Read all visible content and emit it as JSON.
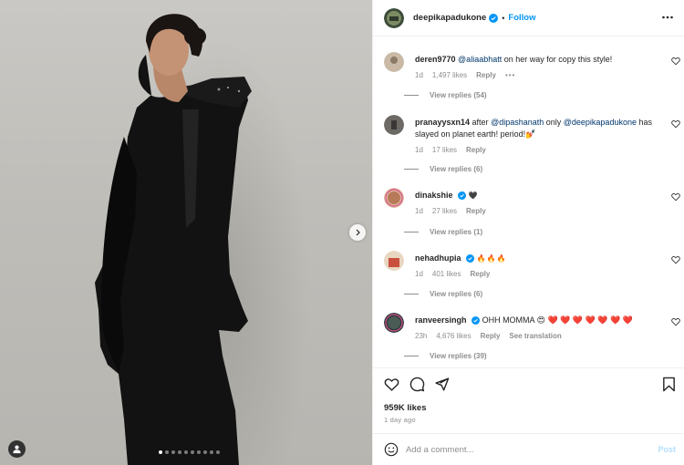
{
  "post": {
    "author": "deepikapadukone",
    "follow_label": "Follow",
    "separator": "•",
    "likes": "959K likes",
    "time_ago": "1 day ago",
    "carousel": {
      "total": 10,
      "active": 0
    }
  },
  "comments": [
    {
      "user": "deren9770",
      "verified": false,
      "mention": "@aliaabhatt",
      "text": " on her way for copy this style!",
      "time": "1d",
      "likes": "1,497 likes",
      "reply": "Reply",
      "more": "•••",
      "view_replies": "View replies (54)",
      "avatar_color": "#c9b9a6"
    },
    {
      "user": "pranayysxn14",
      "verified": false,
      "text_parts": [
        " after ",
        "@dipashanath",
        " only ",
        "@deepikapadukone",
        " has slayed on planet earth! period!💅"
      ],
      "time": "1d",
      "likes": "17 likes",
      "reply": "Reply",
      "view_replies": "View replies (6)",
      "avatar_color": "#6d6a66"
    },
    {
      "user": "dinakshie",
      "verified": true,
      "text": "🖤",
      "time": "1d",
      "likes": "27 likes",
      "reply": "Reply",
      "view_replies": "View replies (1)",
      "avatar_color": "#d6b18f"
    },
    {
      "user": "nehadhupia",
      "verified": true,
      "text": "🔥🔥🔥",
      "time": "1d",
      "likes": "401 likes",
      "reply": "Reply",
      "view_replies": "View replies (6)",
      "avatar_color": "#c94f3e"
    },
    {
      "user": "ranveersingh",
      "verified": true,
      "text": "OHH MOMMA 😍 ❤️ ❤️ ❤️ ❤️ ❤️ ❤️ ❤️",
      "time": "23h",
      "likes": "4,676 likes",
      "reply": "Reply",
      "see_translation": "See translation",
      "view_replies": "View replies (39)",
      "avatar_color": "#4a5a55"
    }
  ],
  "add_comment": {
    "placeholder": "Add a comment...",
    "post_label": "Post"
  },
  "icons": [
    "more-options-icon",
    "verified-badge-icon",
    "heart-icon",
    "comment-icon",
    "share-icon",
    "bookmark-icon",
    "emoji-icon",
    "next-arrow-icon",
    "user-tag-icon"
  ],
  "colors": {
    "accent": "#0095f6",
    "verified": "#0095f6",
    "muted": "#8e8e8e",
    "post_disabled": "#b2dffc"
  }
}
